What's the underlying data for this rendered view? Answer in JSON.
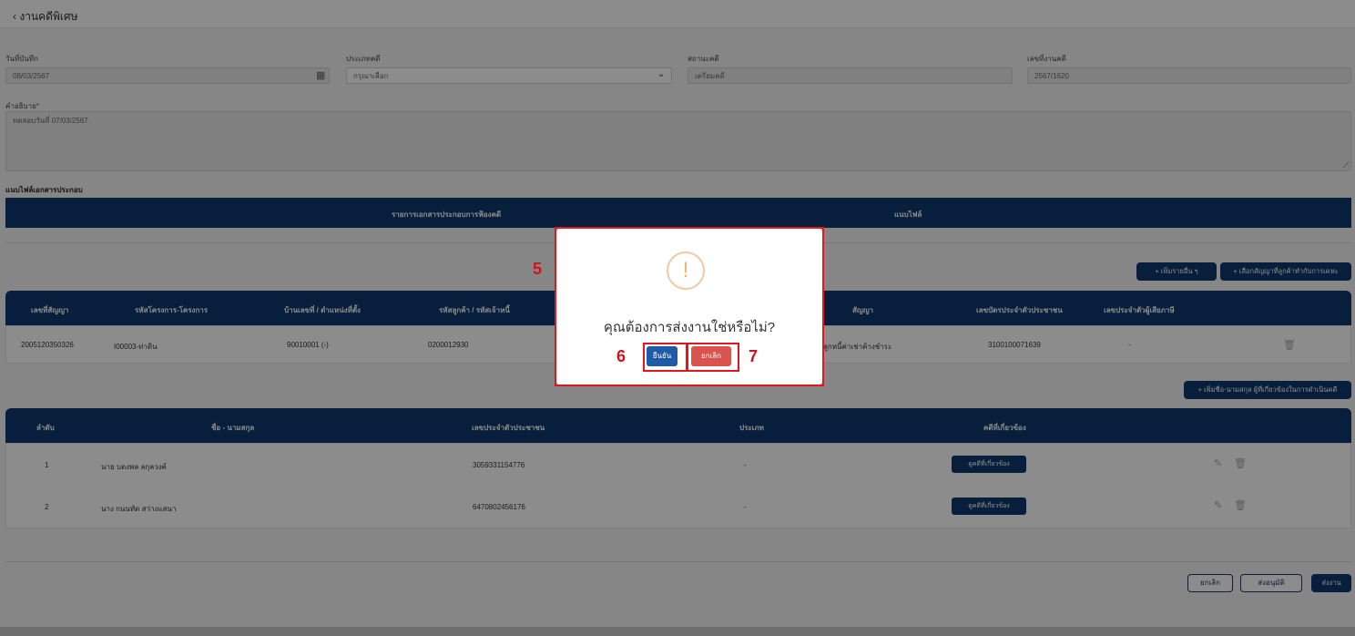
{
  "header": {
    "back_label": "‹  งานคดีพิเศษ"
  },
  "form": {
    "record_date_label": "วันที่บันทึก",
    "record_date_value": "08/03/2567",
    "case_type_label": "ประเภทคดี",
    "case_type_value": "กรุณาเลือก",
    "case_status_label": "สถานะคดี",
    "case_status_value": "เตรียมคดี",
    "case_no_label": "เลขที่งานคดี",
    "case_no_value": "2567/1620",
    "desc_label": "คำอธิบาย",
    "desc_required": "*",
    "desc_value": "ทดสอบวันที่ 07/03/2567"
  },
  "attach": {
    "section_title": "แนบไฟล์เอกสารประกอบ",
    "col_docs": "รายการเอกสารประกอบการฟ้องคดี",
    "col_file": "แนบไฟล์"
  },
  "contract_buttons": {
    "add_other": "+  เพิ่มรายอื่น ๆ",
    "select_contract": "+  เลือกสัญญาที่ลูกค้าทำกับการเคหะ"
  },
  "contracts": {
    "headers": [
      "เลขที่สัญญา",
      "รหัสโครงการ-โครงการ",
      "บ้านเลขที่ / ตำแหน่งที่ตั้ง",
      "รหัสลูกค้า / รหัสเจ้าหนี้",
      "สัญญา",
      "เลขบัตรประจำตัวประชาชน",
      "เลขประจำตัวผู้เสียภาษี"
    ],
    "row": {
      "contract_no": "2005120350326",
      "project": "I00003-ท่าดิน",
      "house_no": "90010001 (-)",
      "customer_code": "0200012930",
      "contract_type": "ลูกหนี้ค่าเช่าค้างชำระ",
      "id_card": "3100100071639",
      "tax_id": "-"
    }
  },
  "person_button": "+  เพิ่มชื่อ-นามสกุล ผู้ที่เกี่ยวข้องในการดำเนินคดี",
  "persons": {
    "headers": [
      "ลำดับ",
      "ชื่อ - นามสกุล",
      "เลขประจำตัวประชาชน",
      "ประเภท",
      "คดีที่เกี่ยวข้อง"
    ],
    "rows": [
      {
        "no": "1",
        "name": "นาย บดงพล ลกุลวงค์",
        "id": "3059331154776",
        "type": "-",
        "action": "ดูคดีที่เกี่ยวข้อง"
      },
      {
        "no": "2",
        "name": "นาง กนนทัต สว่างแสนา",
        "id": "6470802456176",
        "type": "-",
        "action": "ดูคดีที่เกี่ยวข้อง"
      }
    ]
  },
  "footer": {
    "cancel": "ยกเลิก",
    "send_approve": "ส่งอนุมัติ",
    "send": "ส่งงาน"
  },
  "modal": {
    "icon": "!",
    "question": "คุณต้องการส่งงานใช่หรือไม่?",
    "confirm": "ยืนยัน",
    "cancel": "ยกเลิก"
  },
  "annotations": {
    "n5": "5",
    "n6": "6",
    "n7": "7"
  },
  "colors": {
    "navy": "#0d3a6e",
    "red": "#d9534f",
    "confirm": "#1f5aa6",
    "highlight": "#e2161b"
  }
}
